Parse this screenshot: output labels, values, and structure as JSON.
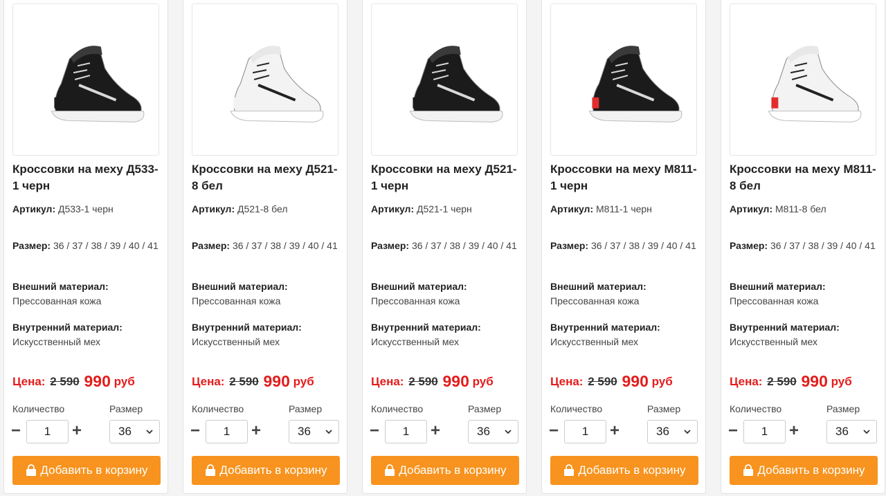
{
  "products": [
    {
      "title": "Кроссовки на меху Д533-1 черн",
      "sku_label": "Артикул:",
      "sku": "Д533-1 черн",
      "sizes_label": "Размер:",
      "sizes": "36 / 37 / 38 / 39 / 40 / 41",
      "outer_label": "Внешний материал:",
      "outer": "Прессованная кожа",
      "inner_label": "Внутренний материал:",
      "inner": "Искусственный мех",
      "price_label": "Цена:",
      "old_price": "2 590",
      "new_price": "990",
      "currency": "руб",
      "qty_label": "Количество",
      "qty": "1",
      "size_select_label": "Размер",
      "size_selected": "36",
      "cart_label": "Добавить в корзину",
      "shoe_color": "black"
    },
    {
      "title": "Кроссовки на меху Д521-8 бел",
      "sku_label": "Артикул:",
      "sku": "Д521-8 бел",
      "sizes_label": "Размер:",
      "sizes": "36 / 37 / 38 / 39 / 40 / 41",
      "outer_label": "Внешний материал:",
      "outer": "Прессованная кожа",
      "inner_label": "Внутренний материал:",
      "inner": "Искусственный мех",
      "price_label": "Цена:",
      "old_price": "2 590",
      "new_price": "990",
      "currency": "руб",
      "qty_label": "Количество",
      "qty": "1",
      "size_select_label": "Размер",
      "size_selected": "36",
      "cart_label": "Добавить в корзину",
      "shoe_color": "white"
    },
    {
      "title": "Кроссовки на меху Д521-1 черн",
      "sku_label": "Артикул:",
      "sku": "Д521-1 черн",
      "sizes_label": "Размер:",
      "sizes": "36 / 37 / 38 / 39 / 40 / 41",
      "outer_label": "Внешний материал:",
      "outer": "Прессованная кожа",
      "inner_label": "Внутренний материал:",
      "inner": "Искусственный мех",
      "price_label": "Цена:",
      "old_price": "2 590",
      "new_price": "990",
      "currency": "руб",
      "qty_label": "Количество",
      "qty": "1",
      "size_select_label": "Размер",
      "size_selected": "36",
      "cart_label": "Добавить в корзину",
      "shoe_color": "black"
    },
    {
      "title": "Кроссовки на меху М811-1 черн",
      "sku_label": "Артикул:",
      "sku": "М811-1 черн",
      "sizes_label": "Размер:",
      "sizes": "36 / 37 / 38 / 39 / 40 / 41",
      "outer_label": "Внешний материал:",
      "outer": "Прессованная кожа",
      "inner_label": "Внутренний материал:",
      "inner": "Искусственный мех",
      "price_label": "Цена:",
      "old_price": "2 590",
      "new_price": "990",
      "currency": "руб",
      "qty_label": "Количество",
      "qty": "1",
      "size_select_label": "Размер",
      "size_selected": "36",
      "cart_label": "Добавить в корзину",
      "shoe_color": "black-red"
    },
    {
      "title": "Кроссовки на меху М811-8 бел",
      "sku_label": "Артикул:",
      "sku": "М811-8 бел",
      "sizes_label": "Размер:",
      "sizes": "36 / 37 / 38 / 39 / 40 / 41",
      "outer_label": "Внешний материал:",
      "outer": "Прессованная кожа",
      "inner_label": "Внутренний материал:",
      "inner": "Искусственный мех",
      "price_label": "Цена:",
      "old_price": "2 590",
      "new_price": "990",
      "currency": "руб",
      "qty_label": "Количество",
      "qty": "1",
      "size_select_label": "Размер",
      "size_selected": "36",
      "cart_label": "Добавить в корзину",
      "shoe_color": "white-red"
    }
  ],
  "icons": {
    "minus": "minus-icon",
    "plus": "plus-icon",
    "cart": "shopping-bag-icon",
    "chevron": "chevron-down-icon"
  },
  "colors": {
    "accent": "#f7931e",
    "price_red": "#e41c1c"
  }
}
